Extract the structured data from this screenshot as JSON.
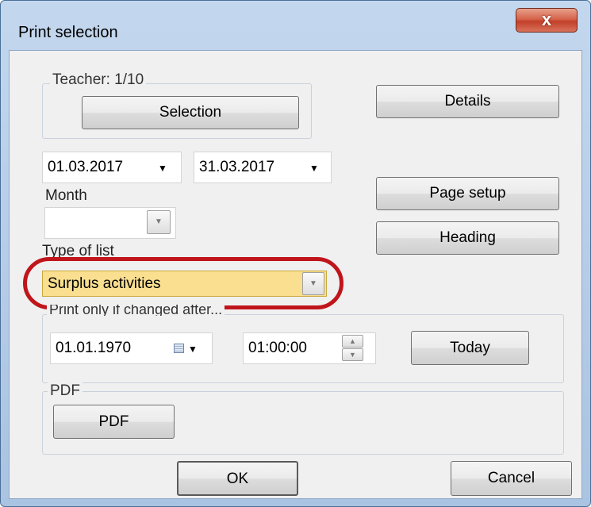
{
  "window": {
    "title": "Print selection",
    "close_glyph": "x"
  },
  "teacher_group": {
    "legend": "Teacher: 1/10",
    "selection_button": "Selection"
  },
  "buttons": {
    "details": "Details",
    "page_setup": "Page setup",
    "heading": "Heading",
    "today": "Today",
    "ok": "OK",
    "cancel": "Cancel",
    "pdf": "PDF"
  },
  "date_range": {
    "from": "01.03.2017",
    "to": "31.03.2017"
  },
  "month": {
    "label": "Month",
    "value": ""
  },
  "type_of_list": {
    "label": "Type of list",
    "value": "Surplus activities"
  },
  "changed_after": {
    "legend": "Print only if changed after...",
    "date": "01.01.1970",
    "time": "01:00:00"
  },
  "pdf_group": {
    "legend": "PDF"
  },
  "highlight": {
    "color": "#c0151b",
    "field_color": "#f9df8f"
  }
}
